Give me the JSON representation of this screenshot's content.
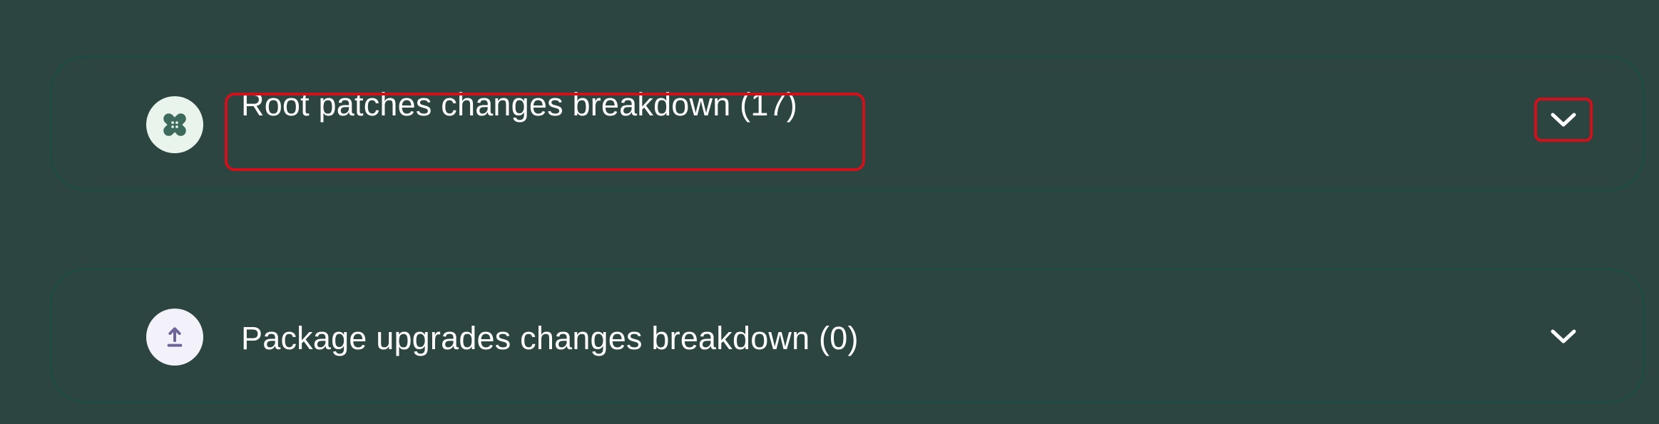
{
  "panels": [
    {
      "title": "Root patches changes breakdown (17)",
      "icon": "bandage-icon",
      "expanded": false,
      "highlighted": true
    },
    {
      "title": "Package upgrades changes breakdown (0)",
      "icon": "upload-icon",
      "expanded": false,
      "highlighted": false
    }
  ],
  "colors": {
    "background": "#2c4541",
    "panel_border": "#1d4a42",
    "highlight": "#d0101b",
    "text": "#ffffff",
    "icon_bg_patches": "#e8f4ec",
    "icon_fg_patches": "#3d6a5c",
    "icon_bg_upgrades": "#f3f1fa",
    "icon_fg_upgrades": "#6f6499"
  }
}
